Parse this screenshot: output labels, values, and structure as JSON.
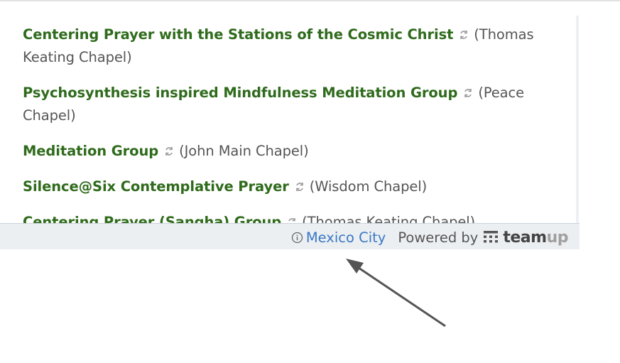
{
  "events": [
    {
      "title": "Centering Prayer with the Stations of the Cosmic Christ",
      "location": "(Thomas Keating Chapel)",
      "icon": "repeat-icon"
    },
    {
      "title": "Psychosynthesis inspired Mindfulness Meditation Group",
      "location": "(Peace Chapel)",
      "icon": "repeat-icon"
    },
    {
      "title": "Meditation Group",
      "location": "(John Main Chapel)",
      "icon": "repeat-icon"
    },
    {
      "title": "Silence@Six Contemplative Prayer",
      "location": "(Wisdom Chapel)",
      "icon": "repeat-icon"
    },
    {
      "title": "Centering Prayer (Sangha) Group",
      "location": "(Thomas Keating Chapel)",
      "icon": "repeat-icon"
    }
  ],
  "footer": {
    "timezone_icon": "info-icon",
    "timezone": "Mexico City",
    "powered_by": "Powered by",
    "brand_part1": "team",
    "brand_part2": "up"
  },
  "colors": {
    "event_title": "#2f6b1c",
    "link": "#3a78c4",
    "text": "#555555",
    "footer_bg": "#eceff2"
  }
}
